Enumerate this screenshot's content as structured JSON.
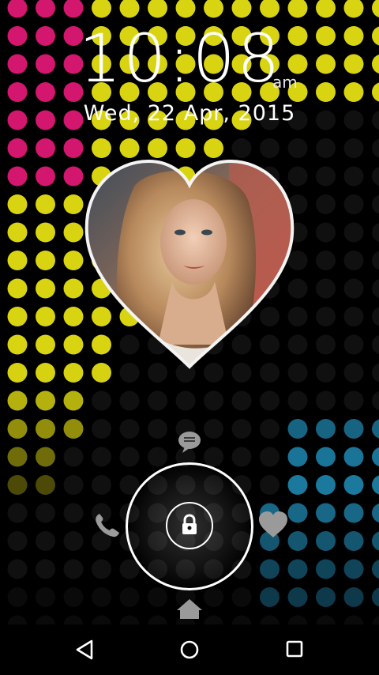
{
  "lockscreen": {
    "time": "10:08",
    "ampm": "am",
    "date": "Wed, 22 Apr, 2015"
  },
  "colors": {
    "magenta": "#d3166e",
    "yellow": "#d9d411",
    "blue": "#1d7fa6",
    "dim": "#1e1e1e",
    "ring": "#ffffff"
  },
  "icons": {
    "message": "message-icon",
    "phone": "phone-icon",
    "favorite": "heart-icon",
    "home": "home-icon",
    "lock": "lock-icon",
    "nav_back": "back-icon",
    "nav_home": "nav-home-icon",
    "nav_recents": "recents-icon"
  }
}
